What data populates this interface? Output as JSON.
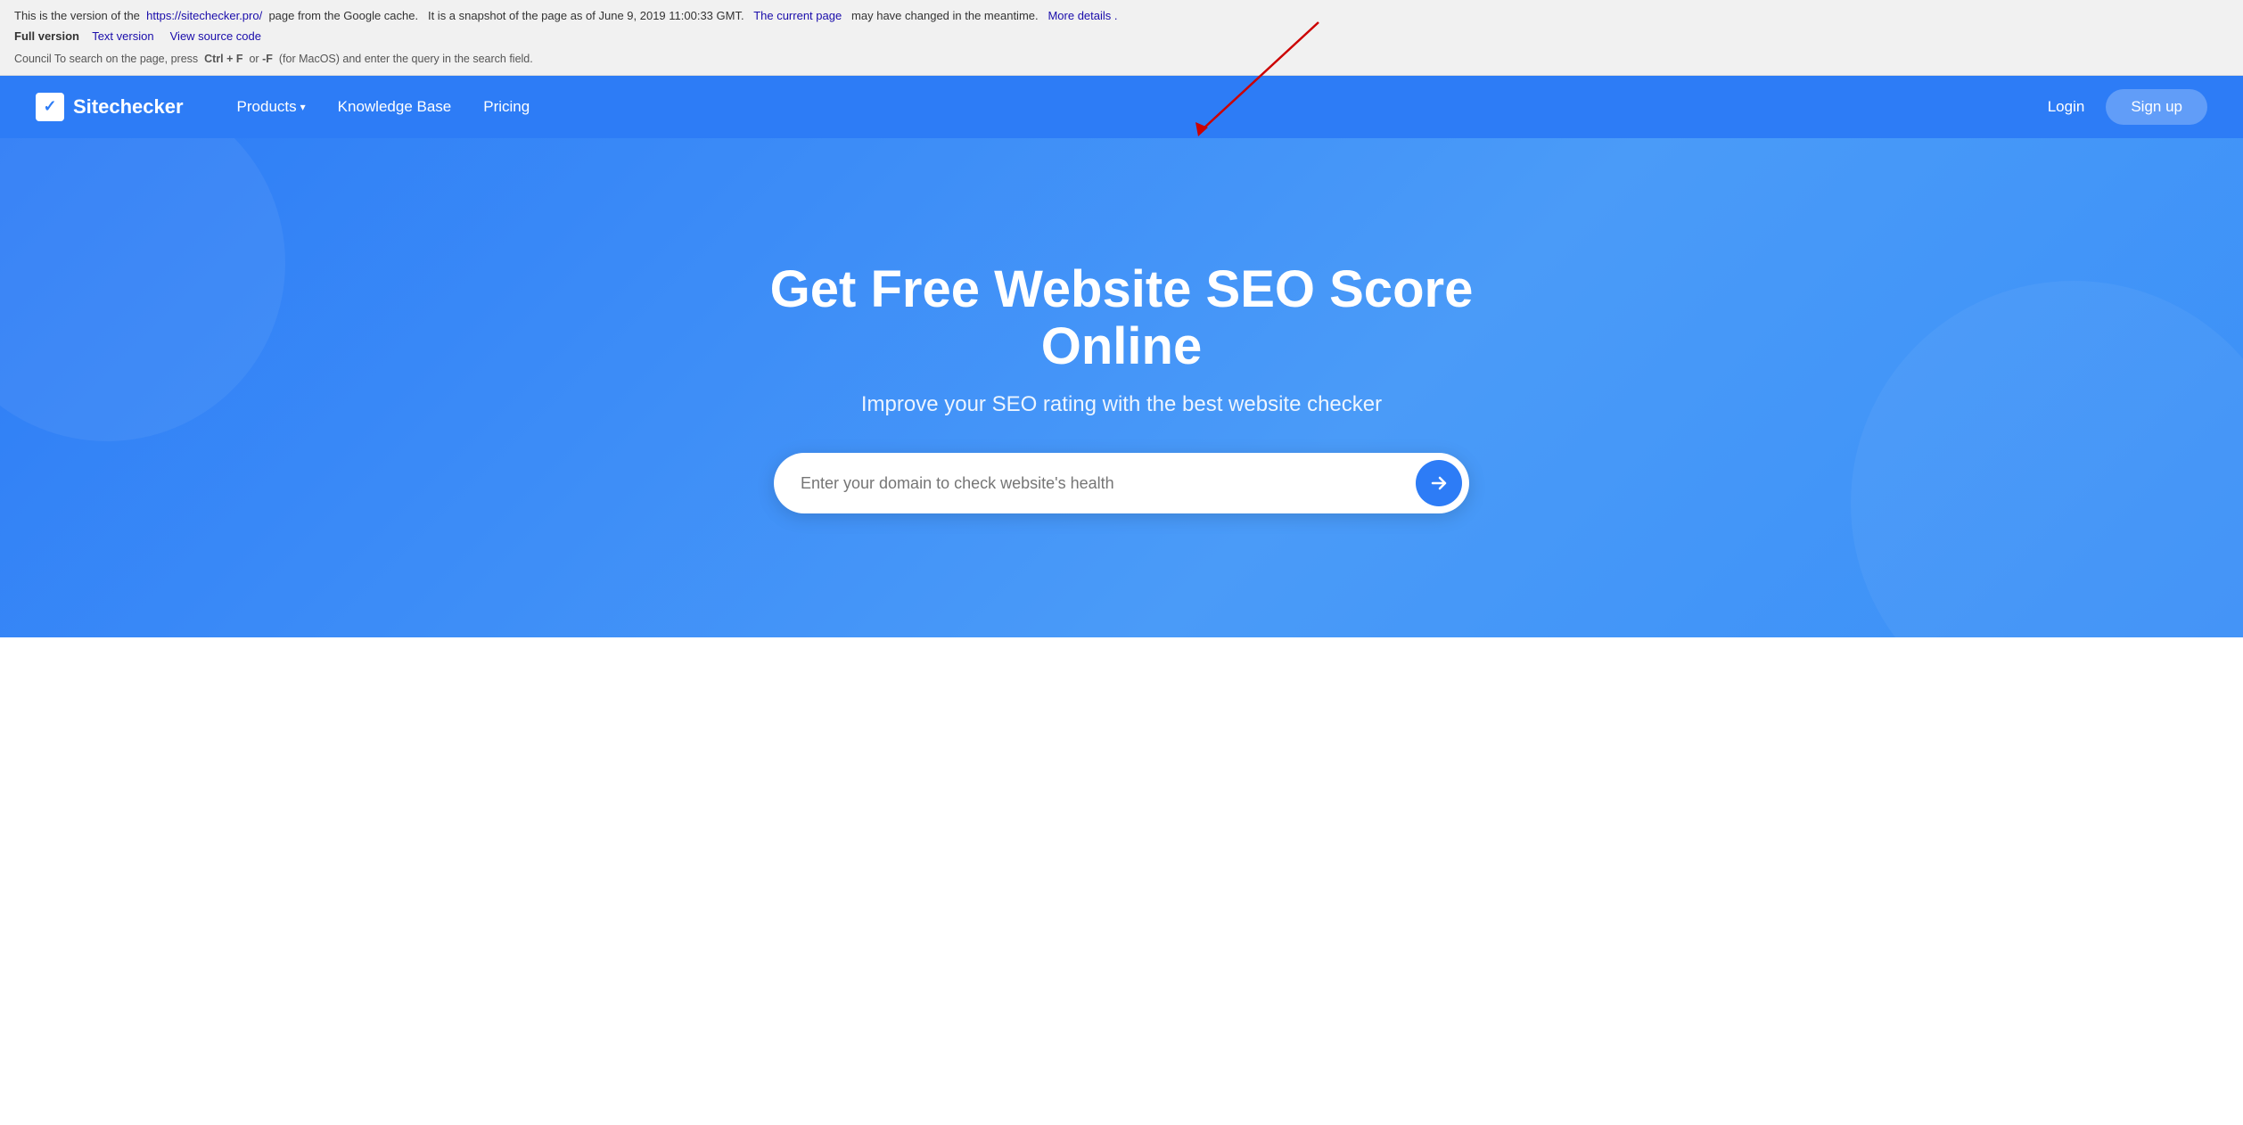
{
  "cache_banner": {
    "line1_prefix": "This is the version of the",
    "url": "https://sitechecker.pro/",
    "line1_suffix": "page from the Google cache.",
    "snapshot_text": "It is a snapshot of the page as of June 9, 2019 11:00:33 GMT.",
    "current_page_link": "The current page",
    "line1_end": "may have changed in the meantime.",
    "more_details": "More details .",
    "version_label": "Full version",
    "text_version": "Text version",
    "view_source": "View source code",
    "tip": "Council To search on the page, press",
    "ctrl_f": "Ctrl + F",
    "or_text": "or",
    "dash_f": "-F",
    "mac_tip": "(for MacOS) and enter the query in the search field."
  },
  "navbar": {
    "logo_text": "Sitechecker",
    "nav_items": [
      {
        "label": "Products",
        "has_dropdown": true
      },
      {
        "label": "Knowledge Base",
        "has_dropdown": false
      },
      {
        "label": "Pricing",
        "has_dropdown": false
      }
    ],
    "login_label": "Login",
    "signup_label": "Sign up"
  },
  "hero": {
    "title": "Get Free Website SEO Score Online",
    "subtitle": "Improve your SEO rating with the best website checker",
    "search_placeholder": "Enter your domain to check website's health",
    "search_btn_icon": "arrow-right-icon"
  },
  "colors": {
    "primary_blue": "#2d7cf6",
    "hero_bg": "#3a8af7",
    "white": "#ffffff",
    "link_blue": "#1a0dab",
    "red_annotation": "#cc0000"
  }
}
